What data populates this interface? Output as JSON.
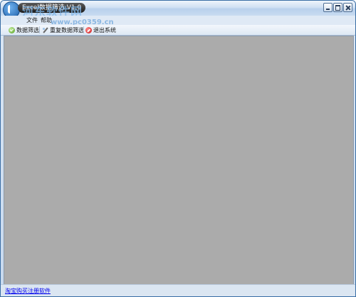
{
  "window": {
    "title": "Excel数据筛选 V1.0",
    "watermark": "河东软件网",
    "watermark_url": "www.pc0359.cn"
  },
  "menu": {
    "items": [
      {
        "label": "文件"
      },
      {
        "label": "帮助"
      }
    ]
  },
  "toolbar": {
    "filter_label": "数据筛选",
    "reset_label": "重复数据筛选",
    "exit_label": "退出系统"
  },
  "status": {
    "link_label": "淘宝购买注册软件"
  },
  "colors": {
    "client_background": "#ababab",
    "link": "#0000ee",
    "title_pill": "#1e1e1e"
  },
  "icons": {
    "app": "app-logo-icon",
    "filter": "check-circle-icon",
    "reset": "broom-icon",
    "exit": "stop-circle-icon"
  }
}
